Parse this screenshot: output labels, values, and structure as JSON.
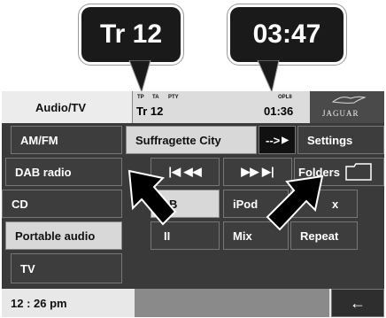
{
  "callouts": {
    "track": "Tr 12",
    "time": "03:47"
  },
  "header": {
    "source_tab": "Audio/TV",
    "flags": [
      "TP",
      "TA",
      "PTY"
    ],
    "track": "Tr 12",
    "mode": "OPLII",
    "time": "01:36",
    "brand": "JAGUAR"
  },
  "sidebar": {
    "items": [
      {
        "label": "AM/FM"
      },
      {
        "label": "DAB radio"
      },
      {
        "label": "CD"
      },
      {
        "label": "Portable audio"
      },
      {
        "label": "TV"
      }
    ]
  },
  "main": {
    "song_title": "Suffragette City",
    "scroll_arrow": "-->",
    "settings": "Settings",
    "prev_label": "|◀ ◀◀",
    "next_label": "▶▶ ▶|",
    "folders": "Folders",
    "b_label": "B",
    "ipod": "iPod",
    "pause": "II",
    "mix": "Mix",
    "repeat": "Repeat",
    "partial_right": "x"
  },
  "status": {
    "clock": "12 : 26 pm",
    "back_arrow": "←"
  }
}
